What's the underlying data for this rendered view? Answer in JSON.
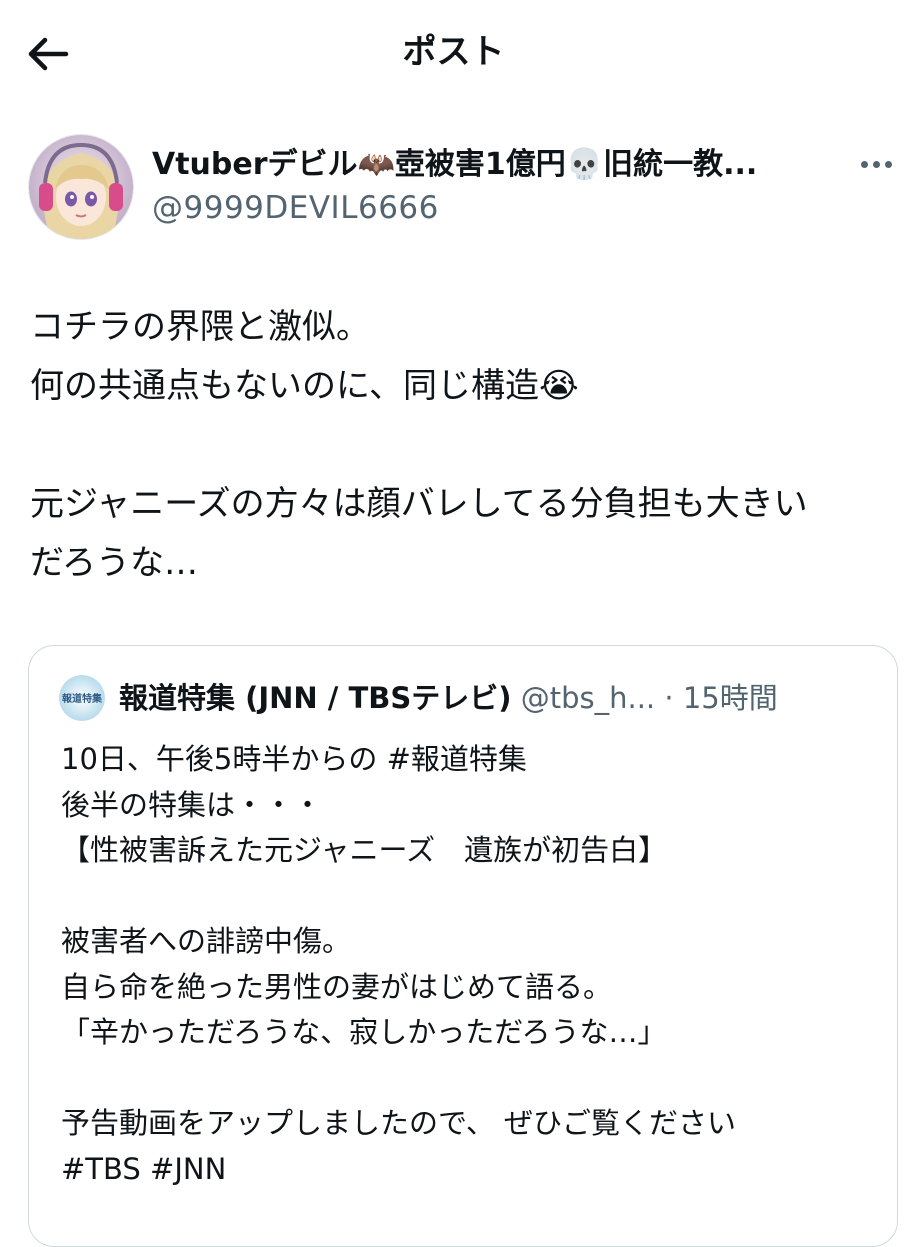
{
  "header": {
    "title": "ポスト",
    "back_icon": "back-arrow-icon"
  },
  "post": {
    "author_name": "Vtuberデビル🦇壺被害1億円💀旧統一教...",
    "author_handle": "@9999DEVIL6666",
    "more_icon": "more-dots-icon",
    "lines": [
      "コチラの界隈と激似。",
      "何の共通点もないのに、同じ構造😭",
      "",
      "元ジャニーズの方々は顔バレしてる分負担も大きい",
      "だろうな…"
    ]
  },
  "quote": {
    "avatar_text": "報道特集",
    "name": "報道特集 (JNN / TBSテレビ)",
    "handle": "@tbs_h...",
    "separator": "·",
    "time": "15時間",
    "lines": [
      "10日、午後5時半からの #報道特集",
      "後半の特集は・・・",
      "【性被害訴えた元ジャニーズ　遺族が初告白】",
      "",
      "被害者への誹謗中傷。",
      "自ら命を絶った男性の妻がはじめて語る。",
      "「辛かっただろうな、寂しかっただろうな…」",
      "",
      "予告動画をアップしましたので、 ぜひご覧ください",
      "#TBS #JNN"
    ]
  },
  "colors": {
    "text": "#0f1419",
    "secondary": "#536471",
    "border": "#cfd9de"
  }
}
